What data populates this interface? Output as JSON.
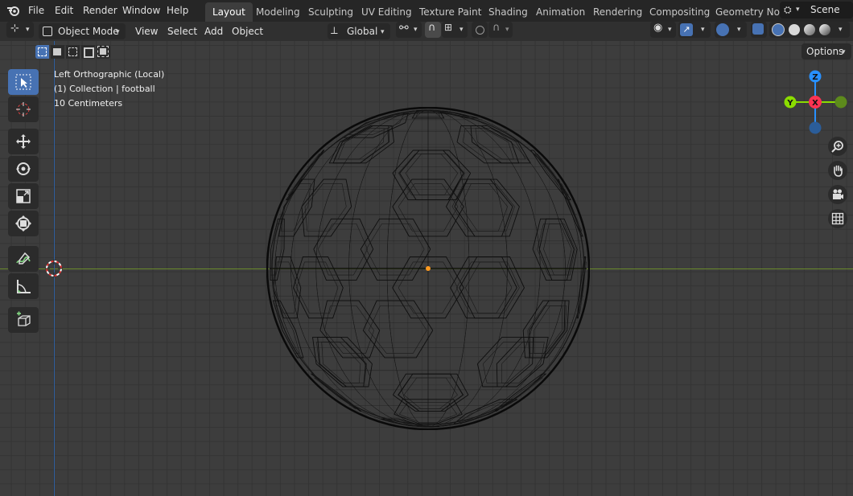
{
  "menubar": {
    "items": [
      "File",
      "Edit",
      "Render",
      "Window",
      "Help"
    ],
    "workspaces": [
      "Layout",
      "Modeling",
      "Sculpting",
      "UV Editing",
      "Texture Paint",
      "Shading",
      "Animation",
      "Rendering",
      "Compositing",
      "Geometry Noc"
    ],
    "scene_label": "Scene"
  },
  "header": {
    "mode": "Object Mode",
    "menus": [
      "View",
      "Select",
      "Add",
      "Object"
    ],
    "orientation": "Global"
  },
  "options_label": "Options",
  "viewport": {
    "view_name": "Left Orthographic (Local)",
    "collection_info": "(1) Collection | football",
    "scale": "10 Centimeters"
  },
  "gizmo": {
    "z": "Z",
    "y": "Y",
    "x": "X"
  },
  "colors": {
    "accent": "#4772b3",
    "x_axis": "#ff3352",
    "y_axis": "#8bdc00",
    "z_axis": "#2890ff"
  },
  "icons": {
    "tools": [
      "select-box-icon",
      "cursor-icon",
      "move-icon",
      "rotate-icon",
      "scale-icon",
      "transform-icon",
      "annotate-icon",
      "measure-icon",
      "add-cube-icon"
    ],
    "nav": [
      "zoom-icon",
      "hand-pan-icon",
      "camera-icon",
      "grid-icon"
    ]
  }
}
